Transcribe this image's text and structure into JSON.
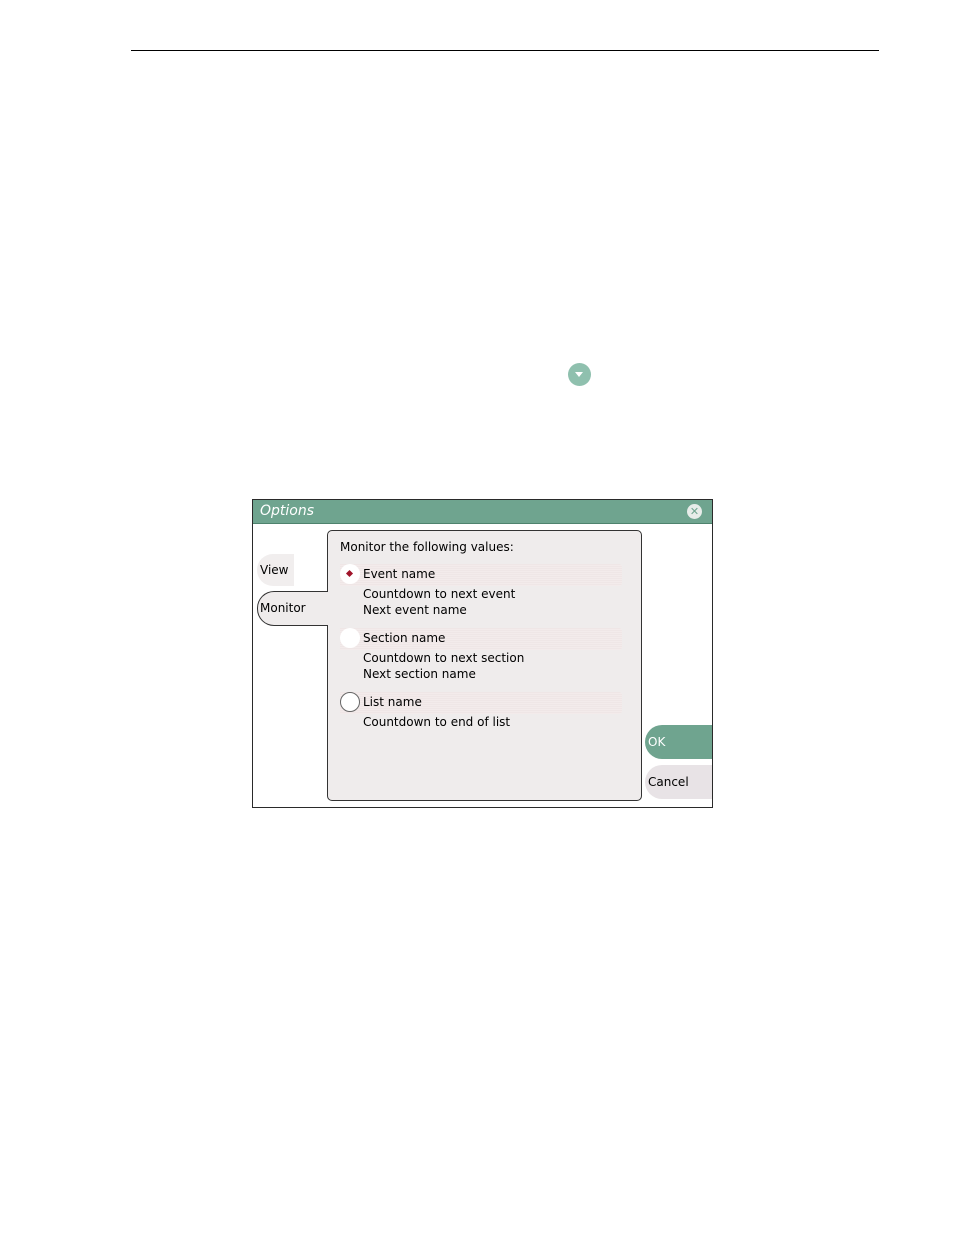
{
  "dialog": {
    "title": "Options",
    "close_icon": "close-icon"
  },
  "tabs": [
    {
      "label": "View",
      "selected": false
    },
    {
      "label": "Monitor",
      "selected": true
    }
  ],
  "panel": {
    "heading": "Monitor the following values:",
    "options": [
      {
        "label": "Event name",
        "selected": true,
        "lines": [
          "Countdown to next event",
          "Next event name"
        ]
      },
      {
        "label": "Section name",
        "selected": false,
        "lines": [
          "Countdown to next section",
          "Next section name"
        ]
      },
      {
        "label": "List name",
        "selected": false,
        "lines": [
          "Countdown to end of list"
        ]
      }
    ]
  },
  "buttons": {
    "ok": "OK",
    "cancel": "Cancel"
  },
  "icons": {
    "dropdown": "chevron-down-icon"
  },
  "colors": {
    "accent": "#6fa48f",
    "dropdown_icon": "#8fc0ae",
    "radio_selected_dot": "#a0142a"
  }
}
